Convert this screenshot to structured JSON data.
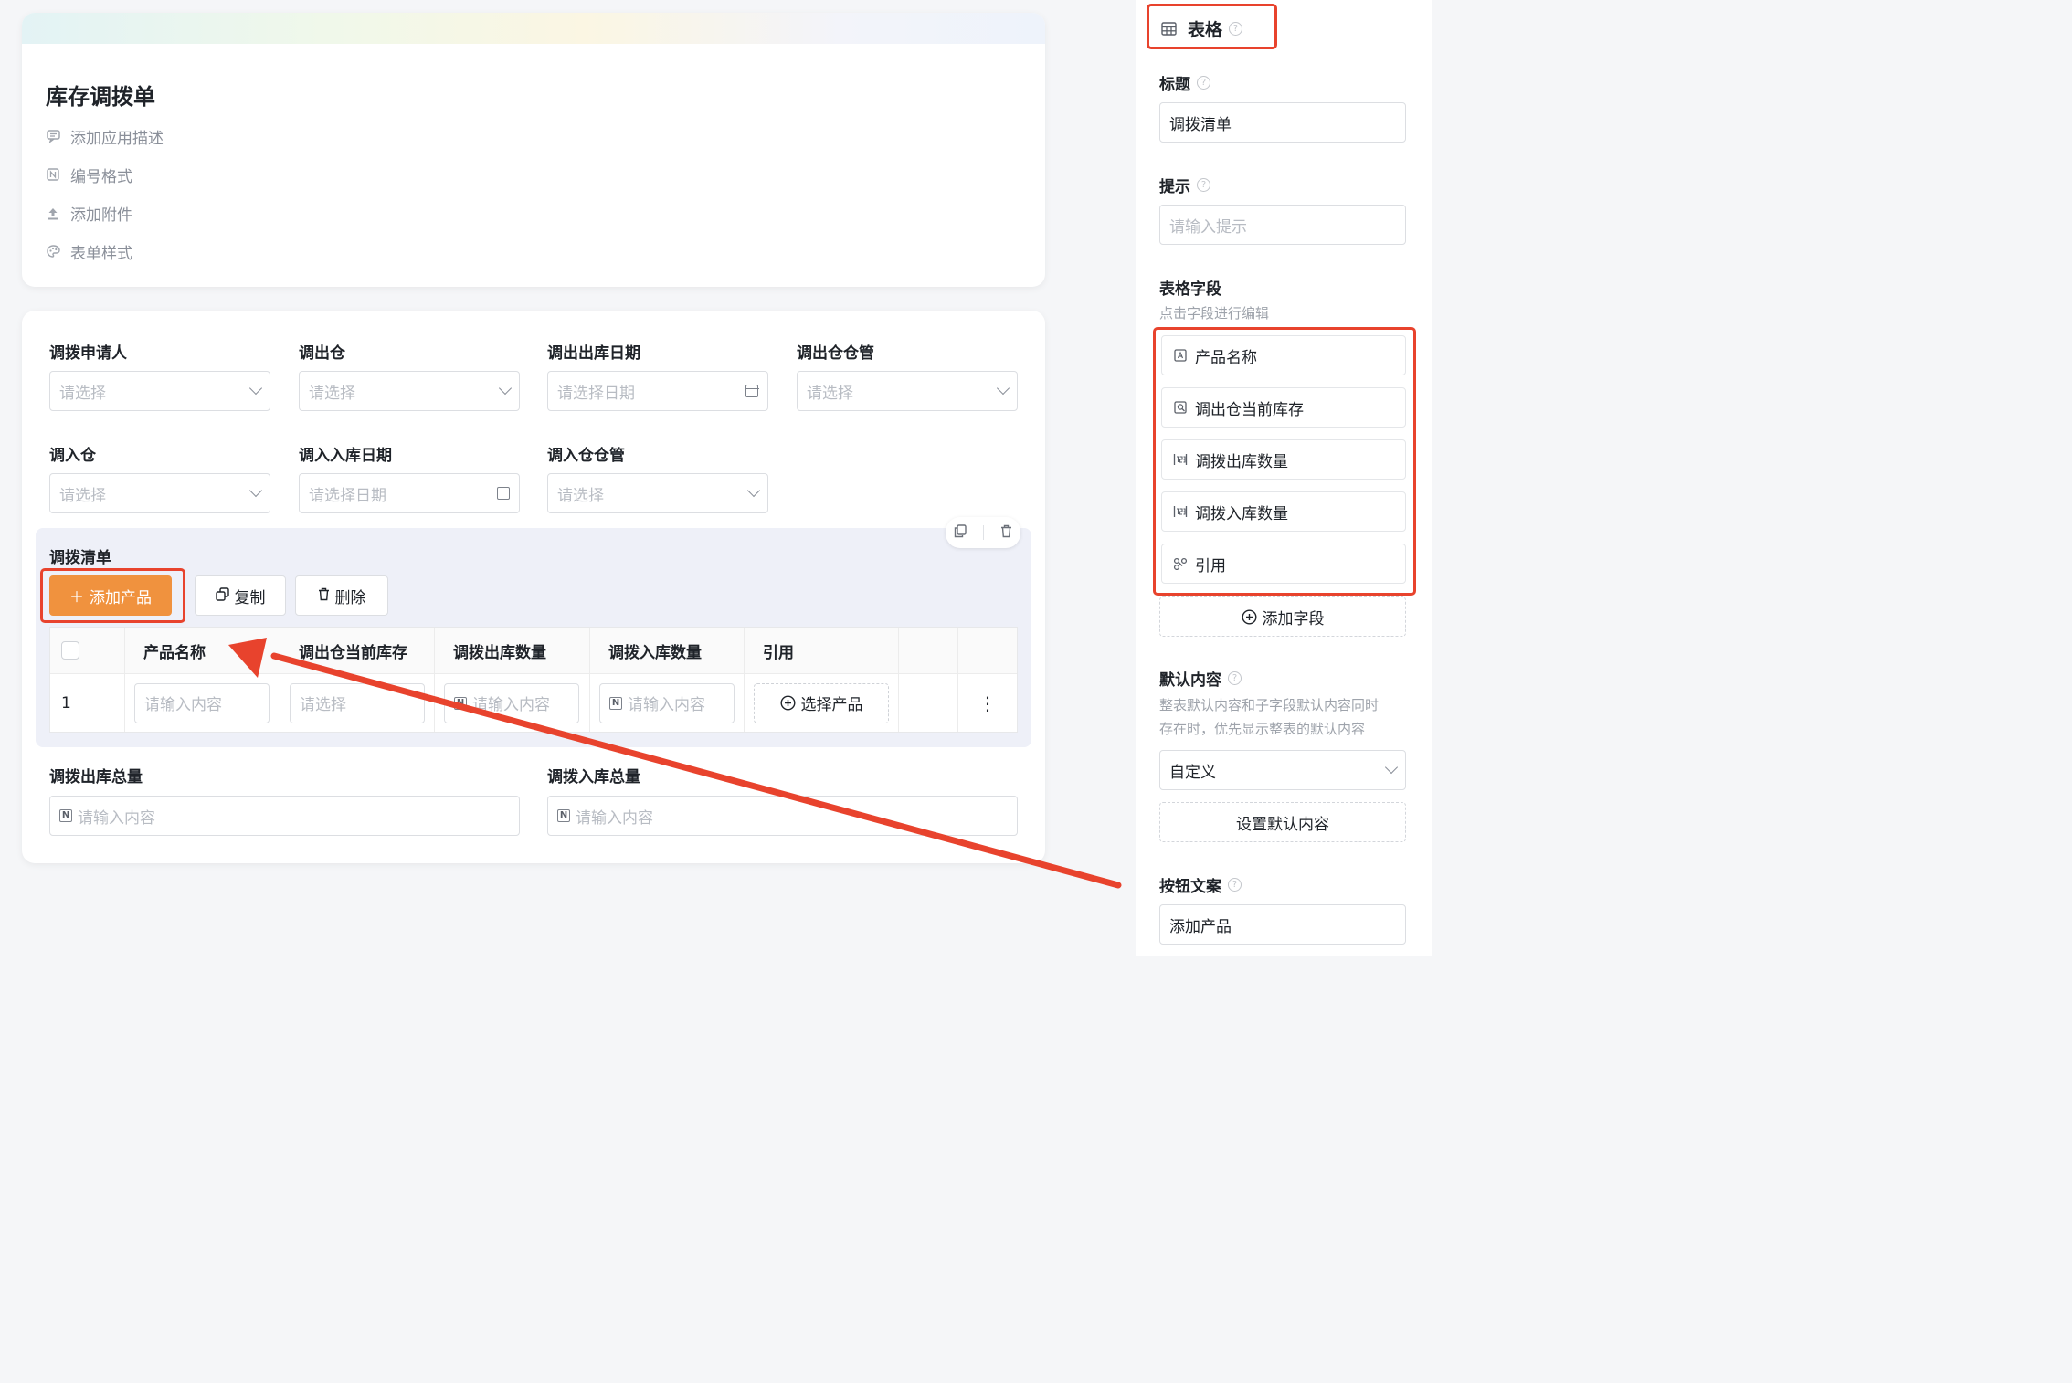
{
  "colors": {
    "accent": "#f0923e",
    "annotation_red": "#e8432d"
  },
  "header": {
    "title": "库存调拨单",
    "items": [
      {
        "icon": "comment-icon",
        "label": "添加应用描述"
      },
      {
        "icon": "number-format-icon",
        "label": "编号格式"
      },
      {
        "icon": "upload-icon",
        "label": "添加附件"
      },
      {
        "icon": "palette-icon",
        "label": "表单样式"
      }
    ]
  },
  "form": {
    "fields": [
      {
        "label": "调拨申请人",
        "placeholder": "请选择"
      },
      {
        "label": "调出仓",
        "placeholder": "请选择"
      },
      {
        "label": "调出出库日期",
        "placeholder": "请选择日期"
      },
      {
        "label": "调出仓仓管",
        "placeholder": "请选择"
      },
      {
        "label": "调入仓",
        "placeholder": "请选择"
      },
      {
        "label": "调入入库日期",
        "placeholder": "请选择日期"
      },
      {
        "label": "调入仓仓管",
        "placeholder": "请选择"
      }
    ],
    "table": {
      "title": "调拨清单",
      "add_button": "添加产品",
      "copy_button": "复制",
      "delete_button": "删除",
      "columns": [
        "产品名称",
        "调出仓当前库存",
        "调拨出库数量",
        "调拨入库数量",
        "引用"
      ],
      "row": {
        "index": "1",
        "product_placeholder": "请输入内容",
        "stock_placeholder": "请选择",
        "out_qty_placeholder": "请输入内容",
        "in_qty_placeholder": "请输入内容",
        "select_product": "选择产品",
        "more": "⋮"
      }
    },
    "totals": [
      {
        "label": "调拨出库总量",
        "placeholder": "请输入内容"
      },
      {
        "label": "调拨入库总量",
        "placeholder": "请输入内容"
      }
    ]
  },
  "sidebar": {
    "heading": "表格",
    "title_label": "标题",
    "title_value": "调拨清单",
    "hint_label": "提示",
    "hint_placeholder": "请输入提示",
    "fields_label": "表格字段",
    "fields_sub": "点击字段进行编辑",
    "fields": [
      {
        "icon": "text-field-icon",
        "label": "产品名称"
      },
      {
        "icon": "lookup-icon",
        "label": "调出仓当前库存"
      },
      {
        "icon": "number-field-icon",
        "label": "调拨出库数量"
      },
      {
        "icon": "number-field-icon",
        "label": "调拨入库数量"
      },
      {
        "icon": "reference-icon",
        "label": "引用"
      }
    ],
    "add_field": "添加字段",
    "default_label": "默认内容",
    "default_desc_1": "整表默认内容和子字段默认内容同时",
    "default_desc_2": "存在时，优先显示整表的默认内容",
    "default_select": "自定义",
    "default_set_button": "设置默认内容",
    "button_text_label": "按钮文案",
    "button_text_value": "添加产品"
  }
}
